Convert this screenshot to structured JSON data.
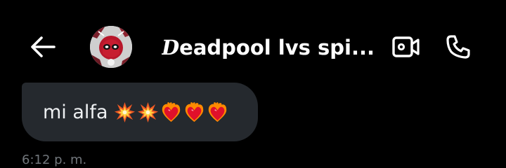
{
  "header": {
    "back_icon": "arrow-left-icon",
    "title_initial": "D",
    "title_rest": "eadpool lvs spi...",
    "video_icon": "video-camera-icon",
    "call_icon": "phone-icon"
  },
  "message": {
    "text": "mi alfa",
    "emojis": [
      "collision-emoji",
      "collision-emoji",
      "heart-on-fire-emoji",
      "heart-on-fire-emoji",
      "heart-on-fire-emoji"
    ],
    "timestamp": "6:12 p. m."
  },
  "colors": {
    "background": "#000000",
    "bubble": "#25292e",
    "timestamp": "#71767b"
  }
}
